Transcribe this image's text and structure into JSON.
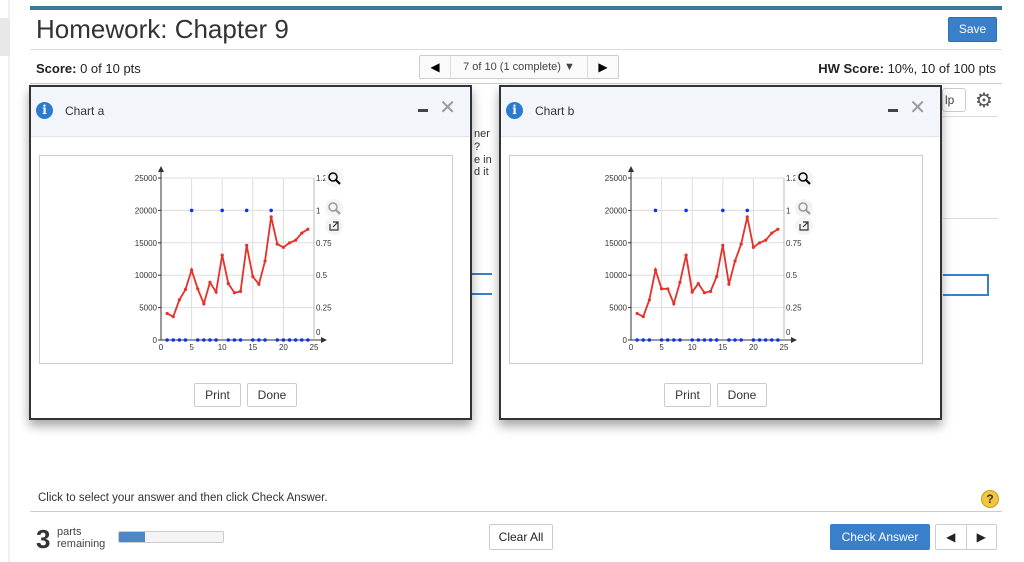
{
  "header": {
    "title": "Homework: Chapter 9",
    "save_label": "Save",
    "score_label": "Score:",
    "score_value": " 0 of 10 pts",
    "nav_label": "7 of 10 (1 complete) ▼",
    "hw_score_label": "HW Score:",
    "hw_score_value": " 10%, 10 of 100 pts"
  },
  "background": {
    "fragments": [
      "ner",
      "?",
      "e in",
      "d it"
    ],
    "help_label": "lp"
  },
  "dialogs": [
    {
      "title": "Chart a",
      "print_label": "Print",
      "done_label": "Done"
    },
    {
      "title": "Chart b",
      "print_label": "Print",
      "done_label": "Done"
    }
  ],
  "chart_data": [
    {
      "type": "line",
      "title": "Chart a",
      "x": [
        1,
        2,
        3,
        4,
        5,
        6,
        7,
        8,
        9,
        10,
        11,
        12,
        13,
        14,
        15,
        16,
        17,
        18,
        19,
        20,
        21,
        22,
        23,
        24
      ],
      "series": [
        {
          "axis": "left",
          "color": "#e8302a",
          "values": [
            4100,
            3600,
            6200,
            7800,
            10800,
            7900,
            5600,
            8900,
            7400,
            13100,
            8700,
            7300,
            7500,
            14600,
            9800,
            8600,
            12200,
            19000,
            14800,
            14300,
            15000,
            15400,
            16500,
            17100
          ]
        },
        {
          "axis": "right",
          "color": "#1030f0",
          "style": "points",
          "values": [
            0,
            0,
            0,
            0,
            1,
            0,
            0,
            0,
            0,
            1,
            0,
            0,
            0,
            1,
            0,
            0,
            0,
            1,
            0,
            0,
            0,
            0,
            0,
            0
          ]
        }
      ],
      "xlim": [
        0,
        25
      ],
      "xticks": [
        0,
        5,
        10,
        15,
        20,
        25
      ],
      "ylim": [
        0,
        25000
      ],
      "yticks": [
        0,
        5000,
        10000,
        15000,
        20000,
        25000
      ],
      "y2lim": [
        0,
        1.25
      ],
      "y2ticks": [
        "0",
        "0.25",
        "0.5",
        "0.75",
        "1",
        "1.25"
      ],
      "grid": true
    },
    {
      "type": "line",
      "title": "Chart b",
      "x": [
        1,
        2,
        3,
        4,
        5,
        6,
        7,
        8,
        9,
        10,
        11,
        12,
        13,
        14,
        15,
        16,
        17,
        18,
        19,
        20,
        21,
        22,
        23,
        24
      ],
      "series": [
        {
          "axis": "left",
          "color": "#e8302a",
          "values": [
            4100,
            3600,
            6200,
            10800,
            7900,
            7900,
            5600,
            8900,
            13100,
            7400,
            8700,
            7300,
            7500,
            9800,
            14600,
            8600,
            12200,
            14800,
            19000,
            14300,
            15000,
            15400,
            16500,
            17100
          ]
        },
        {
          "axis": "right",
          "color": "#1030f0",
          "style": "points",
          "values": [
            0,
            0,
            0,
            1,
            0,
            0,
            0,
            0,
            1,
            0,
            0,
            0,
            0,
            0,
            1,
            0,
            0,
            0,
            1,
            0,
            0,
            0,
            0,
            0
          ]
        }
      ],
      "xlim": [
        0,
        25
      ],
      "xticks": [
        0,
        5,
        10,
        15,
        20,
        25
      ],
      "ylim": [
        0,
        25000
      ],
      "yticks": [
        0,
        5000,
        10000,
        15000,
        20000,
        25000
      ],
      "y2lim": [
        0,
        1.25
      ],
      "y2ticks": [
        "0",
        "0.25",
        "0.5",
        "0.75",
        "1",
        "1.25"
      ],
      "grid": true
    }
  ],
  "footer": {
    "instruction": "Click to select your answer and then click Check Answer.",
    "parts_count": "3",
    "parts_line1": "parts",
    "parts_line2": "remaining",
    "progress_percent": 25,
    "clear_label": "Clear All",
    "check_label": "Check Answer",
    "help_icon": "?"
  }
}
